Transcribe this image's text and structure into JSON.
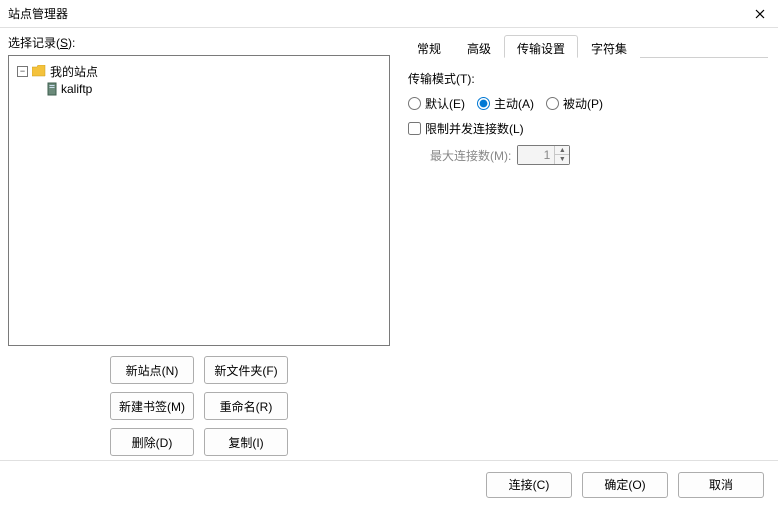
{
  "window": {
    "title": "站点管理器"
  },
  "left": {
    "select_label_pre": "选择记录(",
    "select_label_accel": "S",
    "select_label_post": "):",
    "tree": {
      "root": "我的站点",
      "child": "kaliftp"
    },
    "buttons": {
      "new_site": "新站点(N)",
      "new_folder": "新文件夹(F)",
      "new_bookmark": "新建书签(M)",
      "rename": "重命名(R)",
      "delete": "删除(D)",
      "duplicate": "复制(I)"
    }
  },
  "tabs": {
    "general": "常规",
    "advanced": "高级",
    "transfer": "传输设置",
    "charset": "字符集"
  },
  "transfer": {
    "mode_label": "传输模式(T):",
    "mode_default": "默认(E)",
    "mode_active": "主动(A)",
    "mode_passive": "被动(P)",
    "limit_label": "限制并发连接数(L)",
    "max_label": "最大连接数(M):",
    "max_value": "1"
  },
  "footer": {
    "connect": "连接(C)",
    "ok": "确定(O)",
    "cancel": "取消"
  }
}
